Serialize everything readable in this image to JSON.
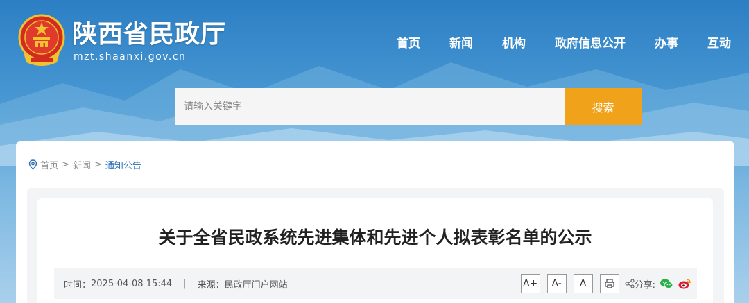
{
  "header": {
    "site_name": "陕西省民政厅",
    "domain": "mzt.shaanxi.gov.cn",
    "nav": [
      "首页",
      "新闻",
      "机构",
      "政府信息公开",
      "办事",
      "互动"
    ]
  },
  "search": {
    "placeholder": "请输入关键字",
    "button_label": "搜索"
  },
  "breadcrumb": {
    "items": [
      "首页",
      "新闻",
      "通知公告"
    ],
    "separator": ">"
  },
  "article": {
    "title": "关于全省民政系统先进集体和先进个人拟表彰名单的公示",
    "time_label": "时间：",
    "time_value": "2025-04-08 15:44",
    "divider": "|",
    "source_label": "来源：",
    "source_value": "民政厅门户网站",
    "font_buttons": [
      "A+",
      "A-",
      "A"
    ],
    "share_label": "分享:"
  },
  "colors": {
    "accent": "#f0a21b",
    "link": "#2a6db5"
  },
  "icons": [
    "emblem-icon",
    "location-pin-icon",
    "print-icon",
    "share-icon",
    "wechat-icon",
    "weibo-icon"
  ]
}
